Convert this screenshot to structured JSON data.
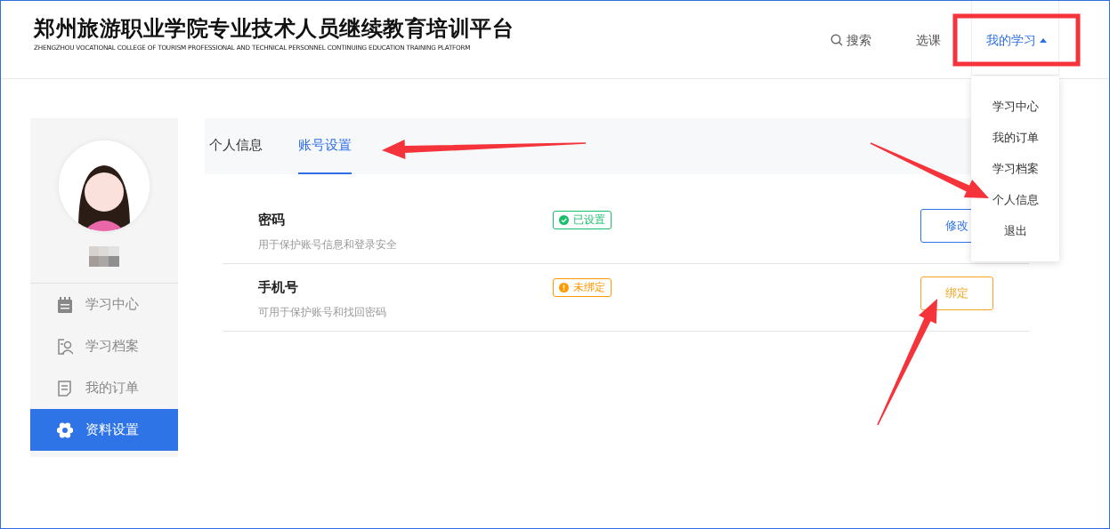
{
  "header": {
    "title": "郑州旅游职业学院专业技术人员继续教育培训平台",
    "subtitle": "ZHENGZHOU VOCATIONAL COLLEGE OF TOURISM PROFESSIONAL AND TECHNICAL PERSONNEL CONTINUING EDUCATION TRAINING PLATFORM",
    "nav": [
      {
        "label": "搜索",
        "kind": "search",
        "selected": false
      },
      {
        "label": "选课",
        "kind": "link",
        "selected": false
      },
      {
        "label": "我的学习",
        "kind": "dropdown",
        "selected": true,
        "expanded": true
      }
    ]
  },
  "dropdown_menu": [
    "学习中心",
    "我的订单",
    "学习档案",
    "个人信息",
    "退出"
  ],
  "sidebar": {
    "items": [
      {
        "label": "学习中心",
        "selected": false
      },
      {
        "label": "学习档案",
        "selected": false
      },
      {
        "label": "我的订单",
        "selected": false
      },
      {
        "label": "资料设置",
        "selected": true
      }
    ]
  },
  "tabs": [
    {
      "label": "个人信息",
      "selected": false
    },
    {
      "label": "账号设置",
      "selected": true
    }
  ],
  "settings": [
    {
      "title": "密码",
      "description": "用于保护账号信息和登录安全",
      "status": {
        "label": "已设置",
        "kind": "ok"
      },
      "action": {
        "label": "修改",
        "kind": "primary"
      }
    },
    {
      "title": "手机号",
      "description": "可用于保护账号和找回密码",
      "status": {
        "label": "未绑定",
        "kind": "warning"
      },
      "action": {
        "label": "绑定",
        "kind": "warning"
      }
    }
  ]
}
